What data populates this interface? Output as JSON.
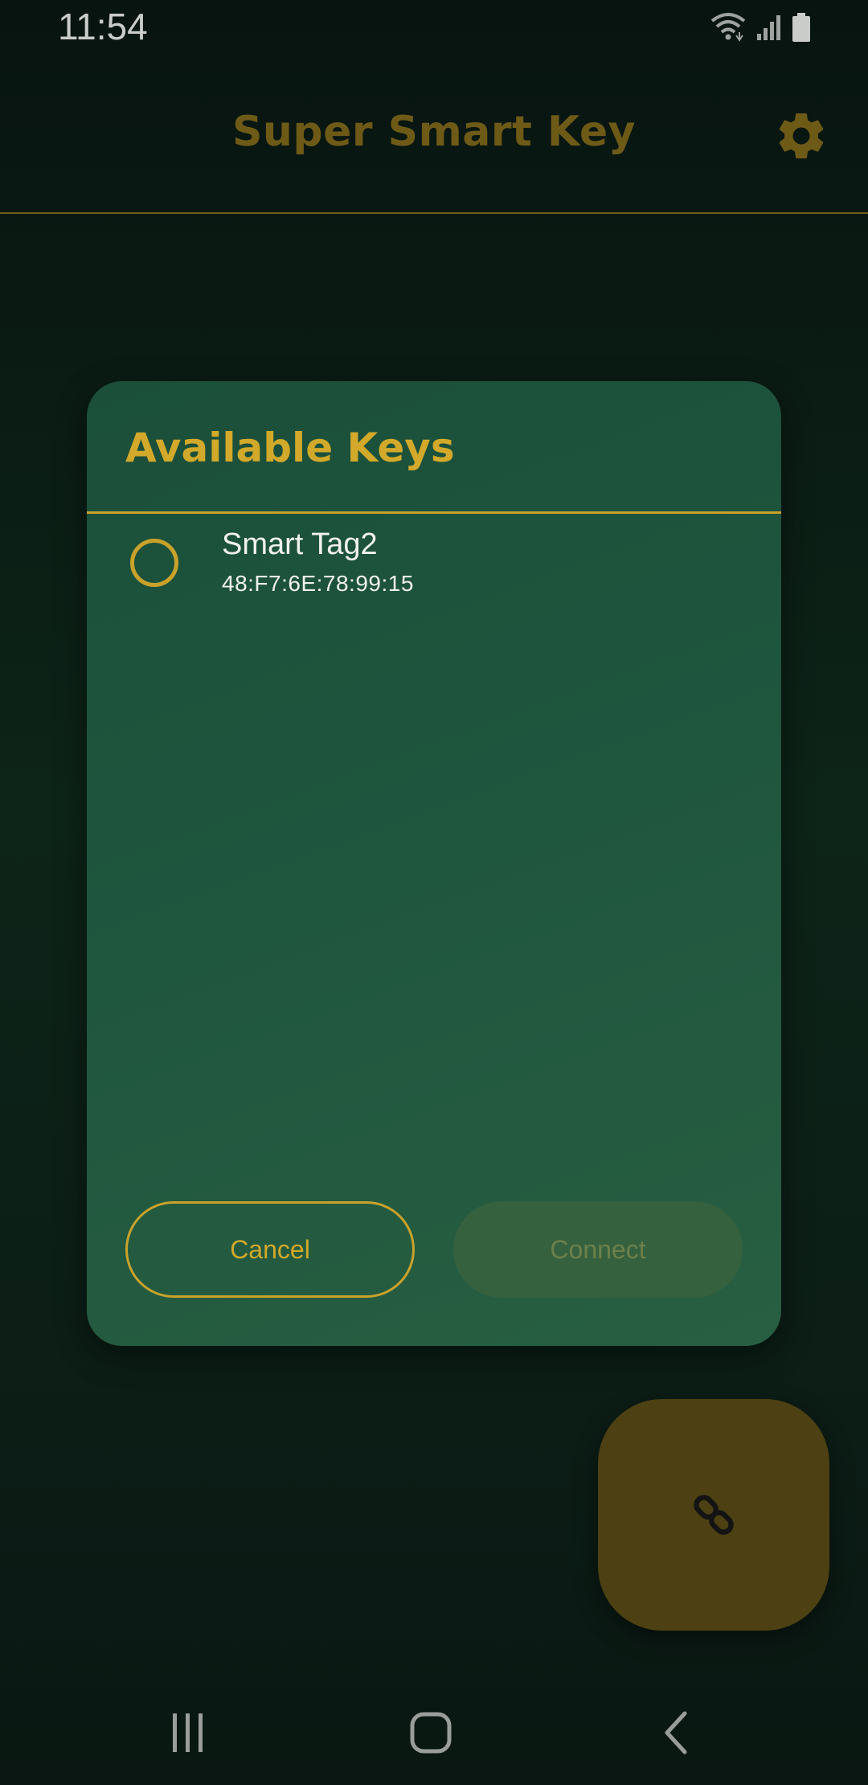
{
  "status_bar": {
    "time": "11:54",
    "icons": [
      "wifi-icon",
      "signal-icon",
      "battery-icon"
    ]
  },
  "app_bar": {
    "title": "Super Smart Key",
    "settings_icon": "gear-icon"
  },
  "dialog": {
    "title": "Available Keys",
    "keys": [
      {
        "name": "Smart Tag2",
        "address": "48:F7:6E:78:99:15",
        "selected": false
      }
    ],
    "cancel_label": "Cancel",
    "connect_label": "Connect",
    "connect_enabled": false
  },
  "fab": {
    "icon": "link-icon"
  },
  "nav_bar": {
    "buttons": [
      "recents-icon",
      "home-icon",
      "back-icon"
    ]
  },
  "colors": {
    "accent": "#c9a22b",
    "background": "#0d2418",
    "dialog": "#1f563e",
    "fab": "#4d4012"
  }
}
